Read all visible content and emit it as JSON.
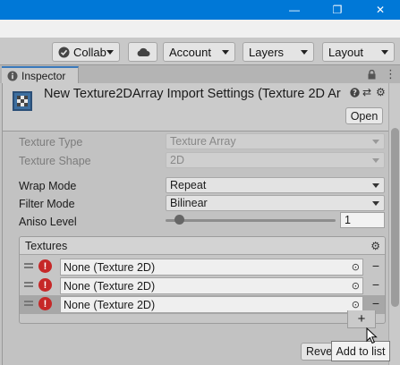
{
  "window": {
    "minimize_glyph": "—",
    "maximize_glyph": "❐",
    "close_glyph": "✕"
  },
  "toolbar": {
    "collab_label": "Collab",
    "account_label": "Account",
    "layers_label": "Layers",
    "layout_label": "Layout"
  },
  "tab": {
    "label": "Inspector"
  },
  "header": {
    "title": "New Texture2DArray Import Settings (Texture 2D Arr",
    "open_label": "Open"
  },
  "fields": {
    "texture_type": {
      "label": "Texture Type",
      "value": "Texture Array"
    },
    "texture_shape": {
      "label": "Texture Shape",
      "value": "2D"
    },
    "wrap_mode": {
      "label": "Wrap Mode",
      "value": "Repeat"
    },
    "filter_mode": {
      "label": "Filter Mode",
      "value": "Bilinear"
    },
    "aniso_level": {
      "label": "Aniso Level",
      "value": "1",
      "fraction": 0.06
    }
  },
  "textures": {
    "header": "Textures",
    "items": [
      {
        "value": "None (Texture 2D)",
        "selected": false
      },
      {
        "value": "None (Texture 2D)",
        "selected": false
      },
      {
        "value": "None (Texture 2D)",
        "selected": true
      }
    ],
    "add_glyph": "+",
    "remove_glyph": "−",
    "error_glyph": "!"
  },
  "footer": {
    "revert_label": "Revert"
  },
  "tooltip": {
    "text": "Add to list"
  },
  "colors": {
    "titlebar": "#0078d7",
    "tab_accent": "#3a79bb",
    "error": "#c62828"
  }
}
